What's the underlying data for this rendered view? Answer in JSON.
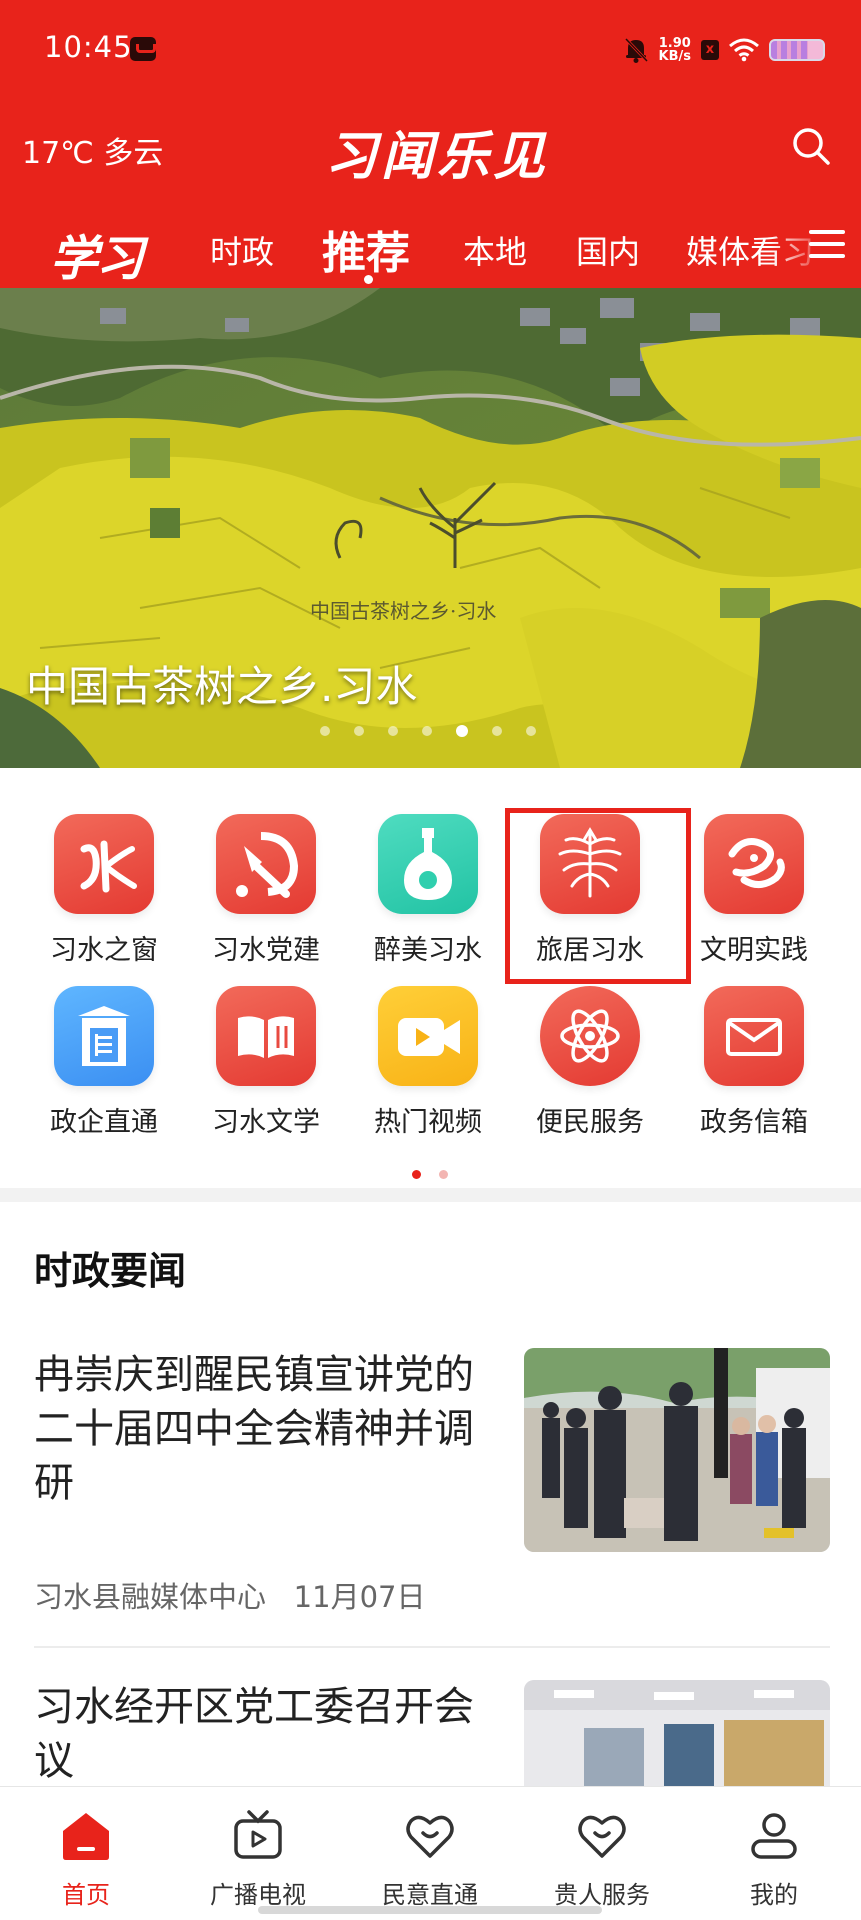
{
  "status_bar": {
    "time": "10:45",
    "net_speed_value": "1.90",
    "net_speed_unit": "KB/s",
    "sim_mark": "x"
  },
  "header": {
    "weather": "17℃ 多云",
    "app_name": "习闻乐见",
    "brand_logo": "学习",
    "tabs": [
      "时政",
      "推荐",
      "本地",
      "国内",
      "媒体看习"
    ],
    "active_tab": "推荐"
  },
  "banner": {
    "caption": "中国古茶树之乡.习水",
    "watermark": "中国古茶树之乡·习水",
    "dot_count": 7,
    "active_dot": 4
  },
  "services": [
    {
      "label": "习水之窗",
      "icon": "calligraphy-icon"
    },
    {
      "label": "习水党建",
      "icon": "hammer-sickle-icon"
    },
    {
      "label": "醉美习水",
      "icon": "liquor-bottle-icon"
    },
    {
      "label": "旅居习水",
      "icon": "phoenix-icon"
    },
    {
      "label": "文明实践",
      "icon": "heart-swirl-icon"
    },
    {
      "label": "政企直通",
      "icon": "building-icon"
    },
    {
      "label": "习水文学",
      "icon": "book-icon"
    },
    {
      "label": "热门视频",
      "icon": "video-camera-icon"
    },
    {
      "label": "便民服务",
      "icon": "atom-icon"
    },
    {
      "label": "政务信箱",
      "icon": "envelope-icon"
    }
  ],
  "grid_pages": {
    "count": 2,
    "active": 0
  },
  "news_section": {
    "title": "时政要闻",
    "items": [
      {
        "title": "冉崇庆到醒民镇宣讲党的二十届四中全会精神并调研",
        "source": "习水县融媒体中心",
        "date": "11月07日"
      },
      {
        "title": "习水经开区党工委召开会议",
        "source": "",
        "date": ""
      }
    ]
  },
  "bottom_nav": [
    {
      "label": "首页",
      "icon": "home-icon",
      "active": true
    },
    {
      "label": "广播电视",
      "icon": "tv-icon",
      "active": false
    },
    {
      "label": "民意直通",
      "icon": "heart-icon",
      "active": false
    },
    {
      "label": "贵人服务",
      "icon": "heart-icon",
      "active": false
    },
    {
      "label": "我的",
      "icon": "user-icon",
      "active": false
    }
  ],
  "colors": {
    "brand_red": "#e8231b",
    "teal": "#22c3a4",
    "blue": "#3b8ff2",
    "yellow": "#f8b216"
  }
}
